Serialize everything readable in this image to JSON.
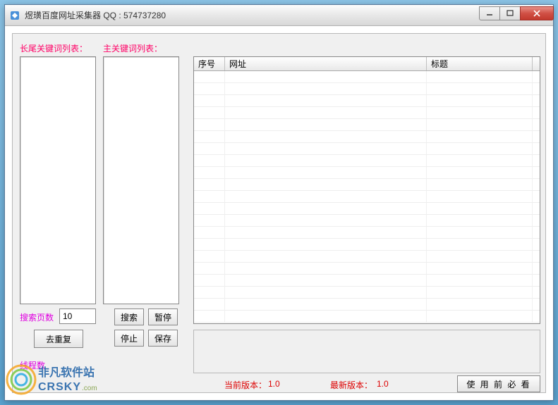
{
  "window": {
    "title": "煜璜百度网址采集器    QQ : 574737280"
  },
  "labels": {
    "longtail_keywords": "长尾关键词列表：",
    "main_keywords": "主关键词列表：",
    "search_pages": "搜索页数",
    "threads": "线程数"
  },
  "inputs": {
    "search_pages_value": "10"
  },
  "buttons": {
    "dedup": "去重复",
    "search": "搜索",
    "pause": "暂停",
    "stop": "停止",
    "save": "保存",
    "must_read": "使 用 前 必 看"
  },
  "grid": {
    "columns": {
      "index": "序号",
      "url": "网址",
      "title": "标题"
    }
  },
  "status": {
    "current_version_label": "当前版本：",
    "current_version": "1.0",
    "latest_version_label": "最新版本：",
    "latest_version": "1.0"
  },
  "watermark": {
    "line1": "非凡软件站",
    "line2": "CRSKY",
    "line2_suffix": ".com"
  }
}
